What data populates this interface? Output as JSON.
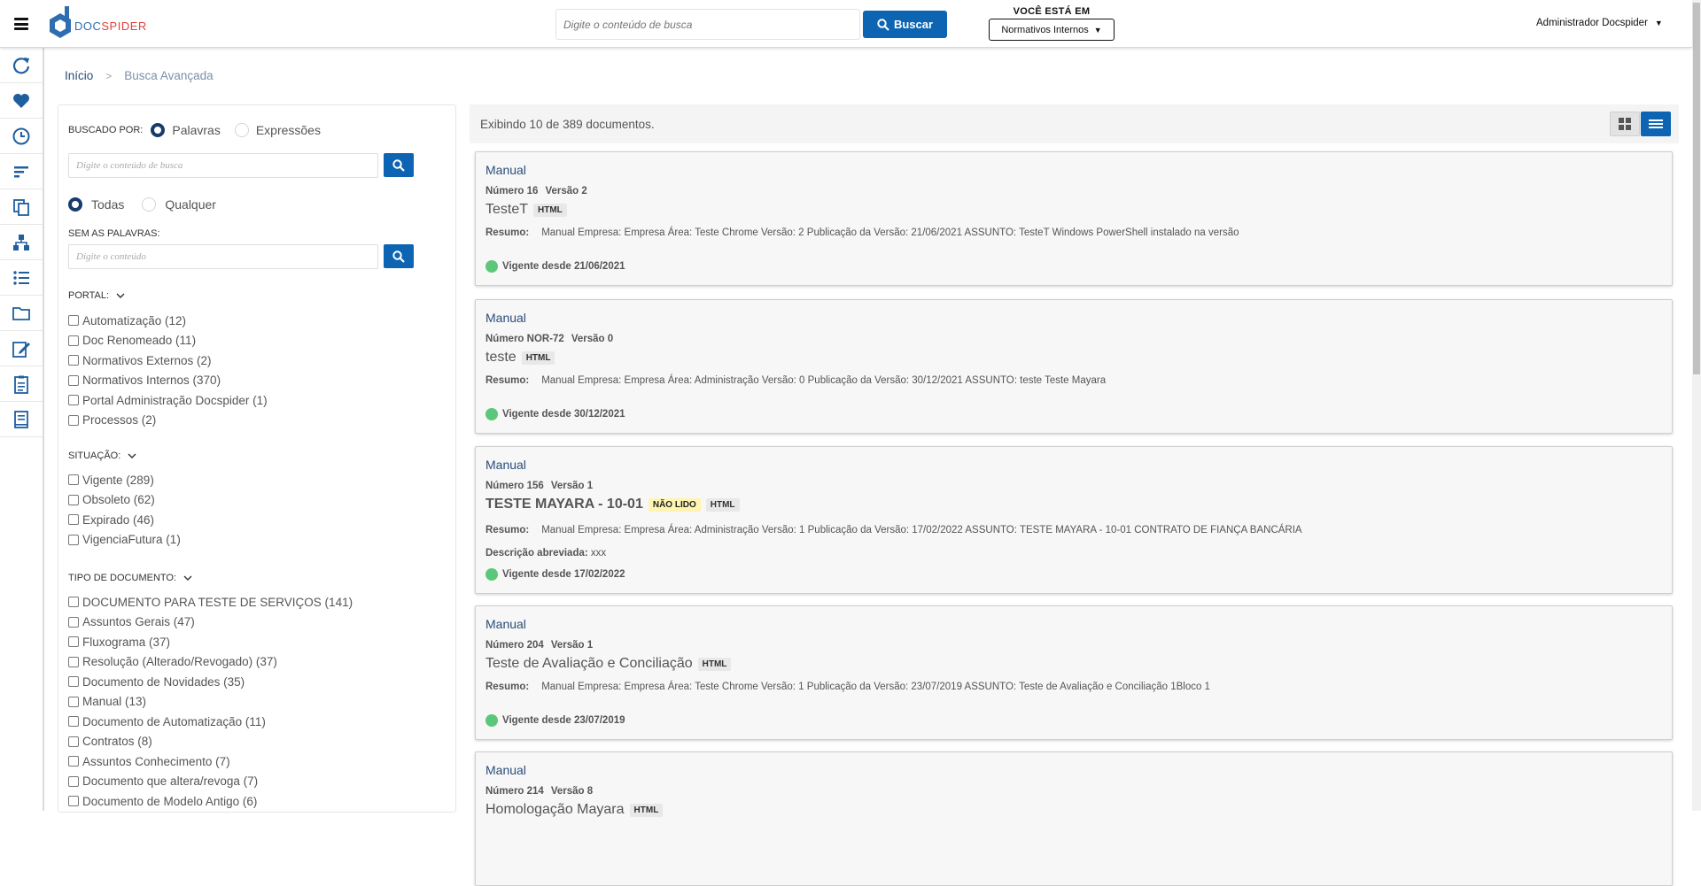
{
  "header": {
    "logo_part1": "DOC",
    "logo_part2": "SPIDER",
    "search_placeholder": "Digite o conteúdo de busca",
    "search_button": "Buscar",
    "location_label": "VOCÊ ESTÁ EM",
    "location_value": "Normativos Internos",
    "user_name": "Administrador Docspider"
  },
  "rail": {
    "icons": [
      "refresh-icon",
      "heart-icon",
      "clock-icon",
      "sort-icon",
      "documents-icon",
      "hierarchy-icon",
      "list-icon",
      "folder-icon",
      "edit-icon",
      "clipboard-icon",
      "book-icon"
    ]
  },
  "breadcrumb": {
    "home": "Início",
    "separator": ">",
    "current": "Busca Avançada"
  },
  "filters": {
    "searched_by_label": "BUSCADO POR:",
    "opt_words": "Palavras",
    "opt_expressions": "Expressões",
    "search_placeholder": "Digite o conteúdo de busca",
    "opt_all": "Todas",
    "opt_any": "Qualquer",
    "without_words_label": "SEM AS PALAVRAS:",
    "without_placeholder": "Digite o conteúdo",
    "portal_label": "PORTAL:",
    "portal_items": [
      "Automatização (12)",
      "Doc Renomeado (11)",
      "Normativos Externos (2)",
      "Normativos Internos (370)",
      "Portal Administração Docspider (1)",
      "Processos (2)"
    ],
    "situacao_label": "SITUAÇÃO:",
    "situacao_items": [
      "Vigente (289)",
      "Obsoleto (62)",
      "Expirado (46)",
      "VigenciaFutura (1)"
    ],
    "tipo_label": "TIPO DE DOCUMENTO:",
    "tipo_items": [
      "DOCUMENTO PARA TESTE DE SERVIÇOS (141)",
      "Assuntos Gerais (47)",
      "Fluxograma (37)",
      "Resolução (Alterado/Revogado) (37)",
      "Documento de Novidades (35)",
      "Manual (13)",
      "Documento de Automatização (11)",
      "Contratos (8)",
      "Assuntos Conhecimento (7)",
      "Documento que altera/revoga (7)",
      "Documento de Modelo Antigo (6)"
    ]
  },
  "results": {
    "count_text": "Exibindo 10 de 389 documentos.",
    "cards": [
      {
        "type": "Manual",
        "number": "Número 16",
        "version": "Versão 2",
        "title": "TesteT",
        "unread": "",
        "format": "HTML",
        "resumo_label": "Resumo:",
        "resumo": "Manual  Empresa: Empresa  Área: Teste Chrome  Versão: 2  Publicação da Versão: 21/06/2021  ASSUNTO: TesteT Windows PowerShell instalado na versão",
        "desc_label": "",
        "desc": "",
        "vigente": "Vigente desde 21/06/2021"
      },
      {
        "type": "Manual",
        "number": "Número NOR-72",
        "version": "Versão 0",
        "title": "teste",
        "unread": "",
        "format": "HTML",
        "resumo_label": "Resumo:",
        "resumo": "Manual  Empresa: Empresa  Área: Administração  Versão: 0  Publicação da Versão: 30/12/2021  ASSUNTO: teste Teste Mayara",
        "desc_label": "",
        "desc": "",
        "vigente": "Vigente desde 30/12/2021"
      },
      {
        "type": "Manual",
        "number": "Número 156",
        "version": "Versão 1",
        "title": "TESTE MAYARA - 10-01",
        "unread": "NÃO LIDO",
        "format": "HTML",
        "resumo_label": "Resumo:",
        "resumo": "Manual  Empresa: Empresa  Área: Administração  Versão: 1  Publicação da Versão: 17/02/2022  ASSUNTO: TESTE MAYARA - 10-01 CONTRATO DE FIANÇA BANCÁRIA",
        "desc_label": "Descrição abreviada:",
        "desc": "xxx",
        "vigente": "Vigente desde 17/02/2022"
      },
      {
        "type": "Manual",
        "number": "Número 204",
        "version": "Versão 1",
        "title": "Teste de Avaliação e Conciliação",
        "unread": "",
        "format": "HTML",
        "resumo_label": "Resumo:",
        "resumo": "Manual  Empresa: Empresa  Área: Teste Chrome  Versão: 1  Publicação da Versão: 23/07/2019  ASSUNTO: Teste de Avaliação e Conciliação  1Bloco 1",
        "desc_label": "",
        "desc": "",
        "vigente": "Vigente desde 23/07/2019"
      },
      {
        "type": "Manual",
        "number": "Número 214",
        "version": "Versão 8",
        "title": "Homologação Mayara",
        "unread": "",
        "format": "HTML",
        "resumo_label": "",
        "resumo": "",
        "desc_label": "",
        "desc": "",
        "vigente": ""
      }
    ]
  },
  "colors": {
    "primary": "#0d64b2",
    "link": "#2a4d7a",
    "vigente_dot": "#5bc879",
    "unread_badge": "#fff4b0"
  }
}
